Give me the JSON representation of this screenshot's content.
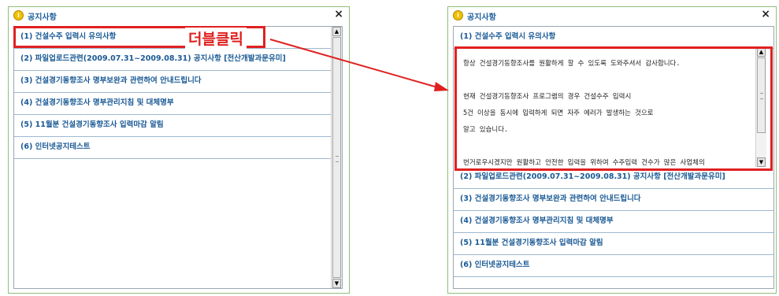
{
  "window": {
    "title": "공지사항",
    "close_glyph": "×"
  },
  "notices": [
    "(1) 건설수주 입력시 유의사항",
    "(2) 파일업로드관련(2009.07.31~2009.08.31) 공지사항 [전산개발과문유미]",
    "(3) 건설경기동향조사 명부보완과 관련하여 안내드립니다",
    "(4) 건설경기동향조사 명부관리지침 및 대체명부",
    "(5) 11월분 건설경기동향조사 입력마감 알림",
    "(6) 인터넷공지테스트"
  ],
  "annotation": {
    "label": "더블클릭",
    "color": "#e02020"
  },
  "detail": {
    "lines": [
      "항상 건설경기동향조사를 원활하게 할 수 있도록 도와주셔서 감사합니다.",
      "",
      "현재 건설경기동향조사 프로그램의 경우 건설수주 입력시",
      "5건 이상을 동시에 입력하게 되면 자주 에러가 발생하는 것으로",
      "알고 있습니다.",
      "",
      "번거로우시겠지만 원활하고 안전한 입력을 위하여 수주입력 건수가 많은 사업체의"
    ]
  },
  "scrollbar": {
    "up_glyph": "▲",
    "down_glyph": "▼"
  }
}
